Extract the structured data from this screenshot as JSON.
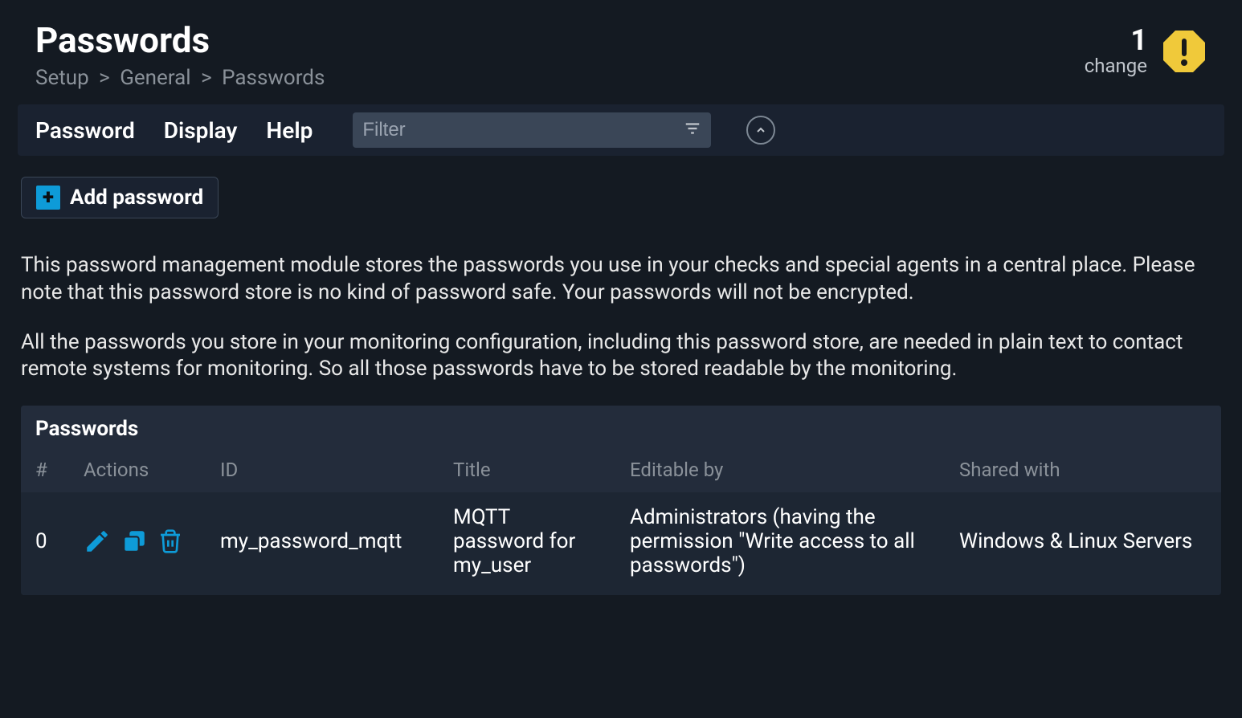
{
  "header": {
    "title": "Passwords",
    "breadcrumb": [
      "Setup",
      "General",
      "Passwords"
    ]
  },
  "changes": {
    "count": "1",
    "label": "change"
  },
  "menubar": {
    "items": [
      "Password",
      "Display",
      "Help"
    ],
    "filter_placeholder": "Filter"
  },
  "actions": {
    "add_label": "Add password"
  },
  "description": {
    "p1": "This password management module stores the passwords you use in your checks and special agents in a central place. Please note that this password store is no kind of password safe. Your passwords will not be encrypted.",
    "p2": "All the passwords you store in your monitoring configuration, including this password store, are needed in plain text to contact remote systems for monitoring. So all those passwords have to be stored readable by the monitoring."
  },
  "table": {
    "title": "Passwords",
    "headers": {
      "num": "#",
      "actions": "Actions",
      "id": "ID",
      "title": "Title",
      "editable": "Editable by",
      "shared": "Shared with"
    },
    "rows": [
      {
        "num": "0",
        "id": "my_password_mqtt",
        "title": "MQTT password for my_user",
        "editable": "Administrators (having the permission \"Write access to all passwords\")",
        "shared": "Windows & Linux Servers"
      }
    ]
  }
}
